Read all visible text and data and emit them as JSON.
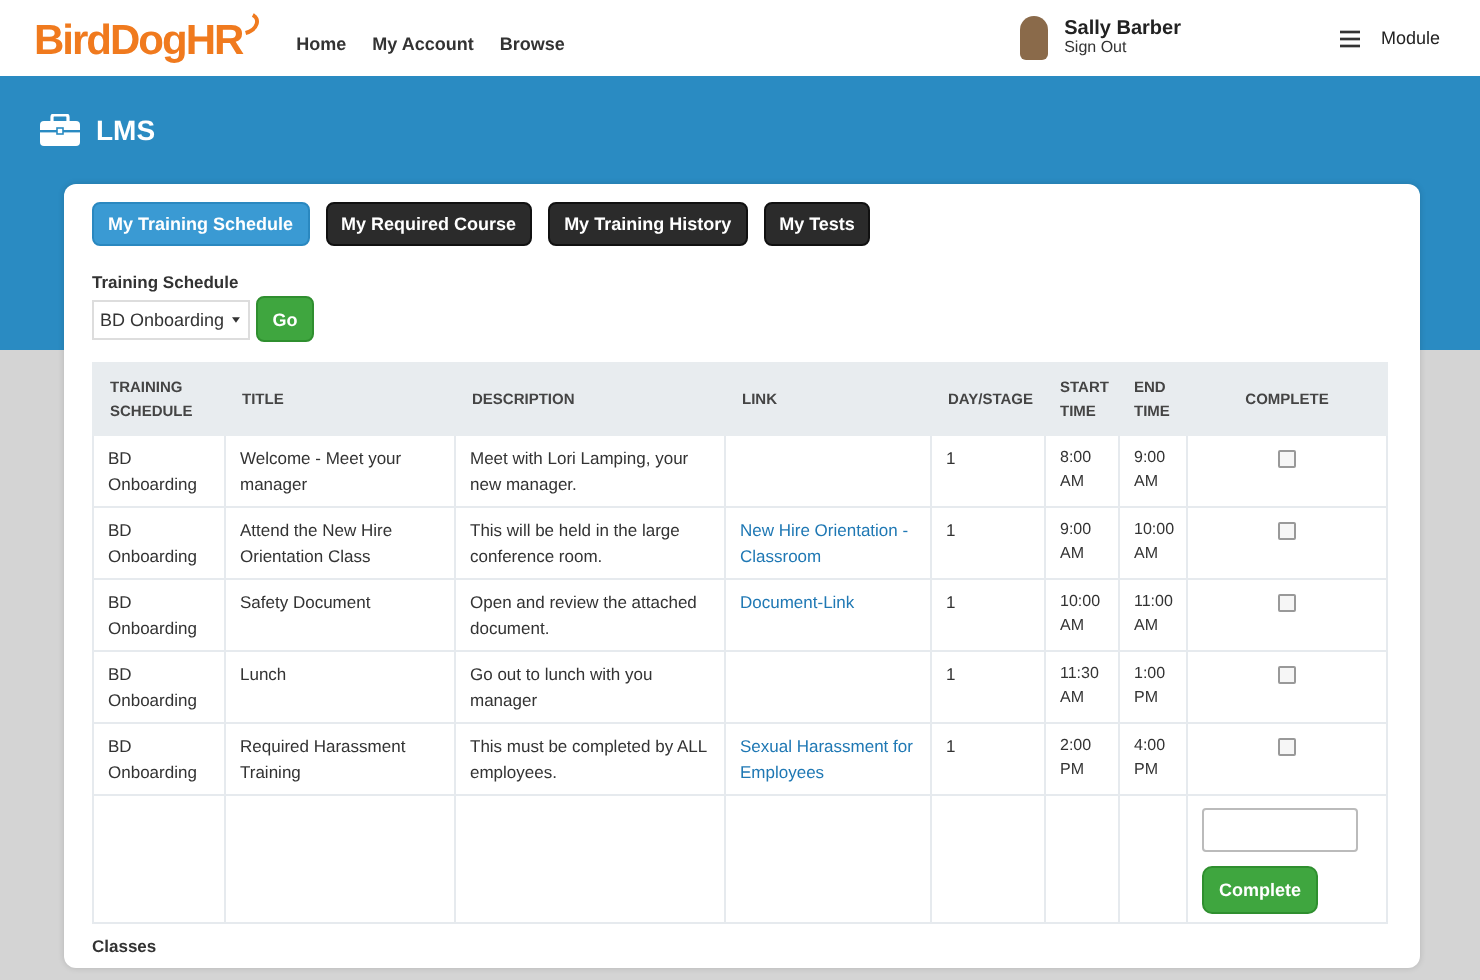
{
  "header": {
    "logo": "BirdDogHR",
    "nav": [
      "Home",
      "My Account",
      "Browse"
    ],
    "user": {
      "name": "Sally Barber",
      "action": "Sign Out"
    },
    "menu": "Module"
  },
  "page_title": "LMS",
  "tabs": [
    {
      "label": "My Training Schedule",
      "selected": true
    },
    {
      "label": "My Required Course",
      "selected": false
    },
    {
      "label": "My Training History",
      "selected": false
    },
    {
      "label": "My Tests",
      "selected": false
    }
  ],
  "filter": {
    "label": "Training Schedule",
    "value": "BD Onboarding",
    "button": "Go"
  },
  "table": {
    "columns": [
      "TRAINING SCHEDULE",
      "TITLE",
      "DESCRIPTION",
      "LINK",
      "DAY/STAGE",
      "START TIME",
      "END TIME",
      "COMPLETE"
    ],
    "rows": [
      {
        "schedule": "BD Onboarding",
        "title": "Welcome - Meet your manager",
        "description": "Meet with Lori Lamping, your new manager.",
        "day": "1",
        "start": "8:00 AM",
        "end": "9:00 AM",
        "checked": false
      },
      {
        "schedule": "BD Onboarding",
        "title": "Attend the New Hire Orientation Class",
        "description": "This will be held in the large conference room.",
        "link": "New Hire Orientation - Classroom",
        "day": "1",
        "start": "9:00 AM",
        "end": "10:00 AM",
        "checked": false
      },
      {
        "schedule": "BD Onboarding",
        "title": "Safety Document",
        "description": "Open and review the attached document.",
        "link": "Document-Link",
        "day": "1",
        "start": "10:00 AM",
        "end": "11:00 AM",
        "checked": false
      },
      {
        "schedule": "BD Onboarding",
        "title": "Lunch",
        "description": "Go out to lunch with you manager",
        "day": "1",
        "start": "11:30 AM",
        "end": "1:00 PM",
        "checked": false
      },
      {
        "schedule": "BD Onboarding",
        "title": "Required Harassment Training",
        "description": "This must be completed by ALL employees.",
        "link": "Sexual Harassment for Employees",
        "day": "1",
        "start": "2:00 PM",
        "end": "4:00 PM",
        "checked": false
      }
    ],
    "complete_button": "Complete"
  },
  "section_heading": "Classes"
}
